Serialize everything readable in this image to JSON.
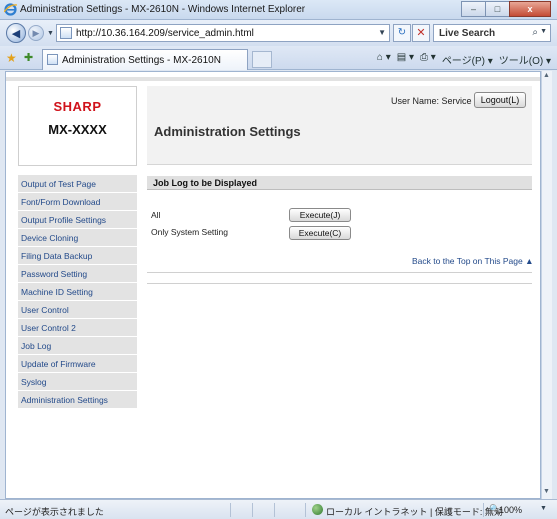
{
  "window": {
    "title": "Administration Settings - MX-2610N - Windows Internet Explorer",
    "minimize": "–",
    "maximize": "□",
    "close": "x"
  },
  "navbar": {
    "back_glyph": "◀",
    "forward_glyph": "▶",
    "url": "http://10.36.164.209/service_admin.html",
    "refresh_glyph": "↻",
    "stop_glyph": "✕",
    "search_placeholder": "Live Search",
    "search_glyph": "⌕"
  },
  "tabbar": {
    "tab_label": "Administration Settings - MX-2610N",
    "commands": [
      "⌂ ▾",
      "▤ ▾",
      "⎙ ▾",
      "ページ(P) ▾",
      "ツール(O) ▾"
    ]
  },
  "header": {
    "brand": "SHARP",
    "model": "MX-XXXX",
    "user_name": "User Name: Service",
    "logout_label": "Logout(L)",
    "page_title": "Administration Settings"
  },
  "sidebar": {
    "items": [
      "Output of Test Page",
      "Font/Form Download",
      "Output Profile Settings",
      "Device Cloning",
      "Filing Data Backup",
      "Password Setting",
      "Machine ID Setting",
      "User Control",
      "User Control 2",
      "Job Log",
      "Update of Firmware",
      "Syslog",
      "Administration Settings"
    ]
  },
  "main": {
    "section_title": "Job Log to be Displayed",
    "rows": [
      {
        "label": "All",
        "button": "Execute(J)"
      },
      {
        "label": "Only System Setting",
        "button": "Execute(C)"
      }
    ],
    "back_to_top": "Back to the Top on This Page ▲"
  },
  "statusbar": {
    "status": "ページが表示されました",
    "zone": "ローカル イントラネット | 保護モード: 無効",
    "zoom": "100%",
    "zoom_glyph": "🔍"
  }
}
